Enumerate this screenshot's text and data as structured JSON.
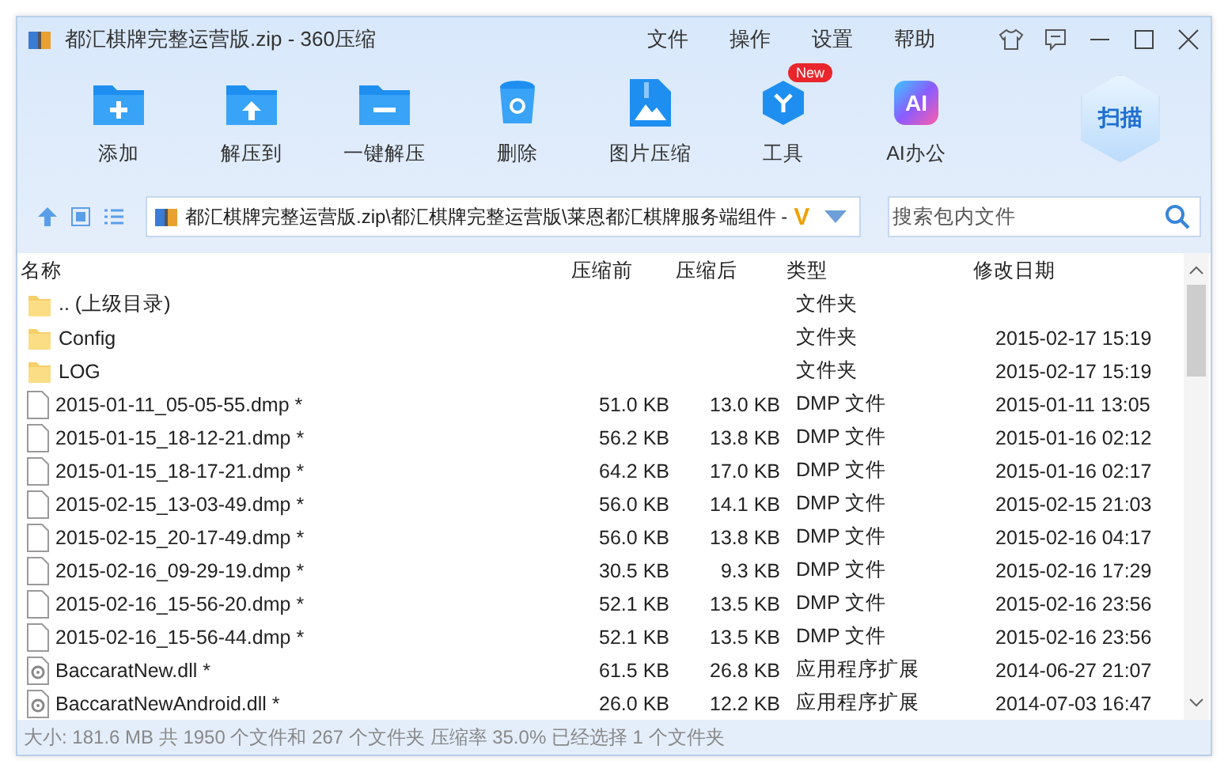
{
  "window": {
    "title": "都汇棋牌完整运营版.zip - 360压缩"
  },
  "menu": [
    "文件",
    "操作",
    "设置",
    "帮助"
  ],
  "toolbar": [
    {
      "label": "添加",
      "kind": "add"
    },
    {
      "label": "解压到",
      "kind": "extract"
    },
    {
      "label": "一键解压",
      "kind": "oneclick"
    },
    {
      "label": "删除",
      "kind": "delete"
    },
    {
      "label": "图片压缩",
      "kind": "image"
    },
    {
      "label": "工具",
      "kind": "tools",
      "badge": "New"
    },
    {
      "label": "AI办公",
      "kind": "ai",
      "glyph": "AI"
    }
  ],
  "scan_button": "扫描",
  "path": {
    "value": "都汇棋牌完整运营版.zip\\都汇棋牌完整运营版\\莱恩都汇棋牌服务端组件 -",
    "mark": "V"
  },
  "search": {
    "placeholder": "搜索包内文件"
  },
  "table": {
    "columns": [
      "名称",
      "压缩前",
      "压缩后",
      "类型",
      "修改日期"
    ],
    "rows": [
      {
        "kind": "up",
        "name": ".. (上级目录)",
        "size": "",
        "packed": "",
        "type": "文件夹",
        "date": ""
      },
      {
        "kind": "folder",
        "name": "Config",
        "size": "",
        "packed": "",
        "type": "文件夹",
        "date": "2015-02-17 15:19"
      },
      {
        "kind": "folder",
        "name": "LOG",
        "size": "",
        "packed": "",
        "type": "文件夹",
        "date": "2015-02-17 15:19"
      },
      {
        "kind": "file",
        "name": "2015-01-11_05-05-55.dmp *",
        "size": "51.0 KB",
        "packed": "13.0 KB",
        "type": "DMP 文件",
        "date": "2015-01-11 13:05"
      },
      {
        "kind": "file",
        "name": "2015-01-15_18-12-21.dmp *",
        "size": "56.2 KB",
        "packed": "13.8 KB",
        "type": "DMP 文件",
        "date": "2015-01-16 02:12"
      },
      {
        "kind": "file",
        "name": "2015-01-15_18-17-21.dmp *",
        "size": "64.2 KB",
        "packed": "17.0 KB",
        "type": "DMP 文件",
        "date": "2015-01-16 02:17"
      },
      {
        "kind": "file",
        "name": "2015-02-15_13-03-49.dmp *",
        "size": "56.0 KB",
        "packed": "14.1 KB",
        "type": "DMP 文件",
        "date": "2015-02-15 21:03"
      },
      {
        "kind": "file",
        "name": "2015-02-15_20-17-49.dmp *",
        "size": "56.0 KB",
        "packed": "13.8 KB",
        "type": "DMP 文件",
        "date": "2015-02-16 04:17"
      },
      {
        "kind": "file",
        "name": "2015-02-16_09-29-19.dmp *",
        "size": "30.5 KB",
        "packed": "9.3 KB",
        "type": "DMP 文件",
        "date": "2015-02-16 17:29"
      },
      {
        "kind": "file",
        "name": "2015-02-16_15-56-20.dmp *",
        "size": "52.1 KB",
        "packed": "13.5 KB",
        "type": "DMP 文件",
        "date": "2015-02-16 23:56"
      },
      {
        "kind": "file",
        "name": "2015-02-16_15-56-44.dmp *",
        "size": "52.1 KB",
        "packed": "13.5 KB",
        "type": "DMP 文件",
        "date": "2015-02-16 23:56"
      },
      {
        "kind": "dll",
        "name": "BaccaratNew.dll *",
        "size": "61.5 KB",
        "packed": "26.8 KB",
        "type": "应用程序扩展",
        "date": "2014-06-27 21:07"
      },
      {
        "kind": "dll",
        "name": "BaccaratNewAndroid.dll *",
        "size": "26.0 KB",
        "packed": "12.2 KB",
        "type": "应用程序扩展",
        "date": "2014-07-03 16:47"
      }
    ]
  },
  "status_bar": "大小: 181.6 MB 共 1950 个文件和 267 个文件夹 压缩率 35.0% 已经选择 1 个文件夹"
}
